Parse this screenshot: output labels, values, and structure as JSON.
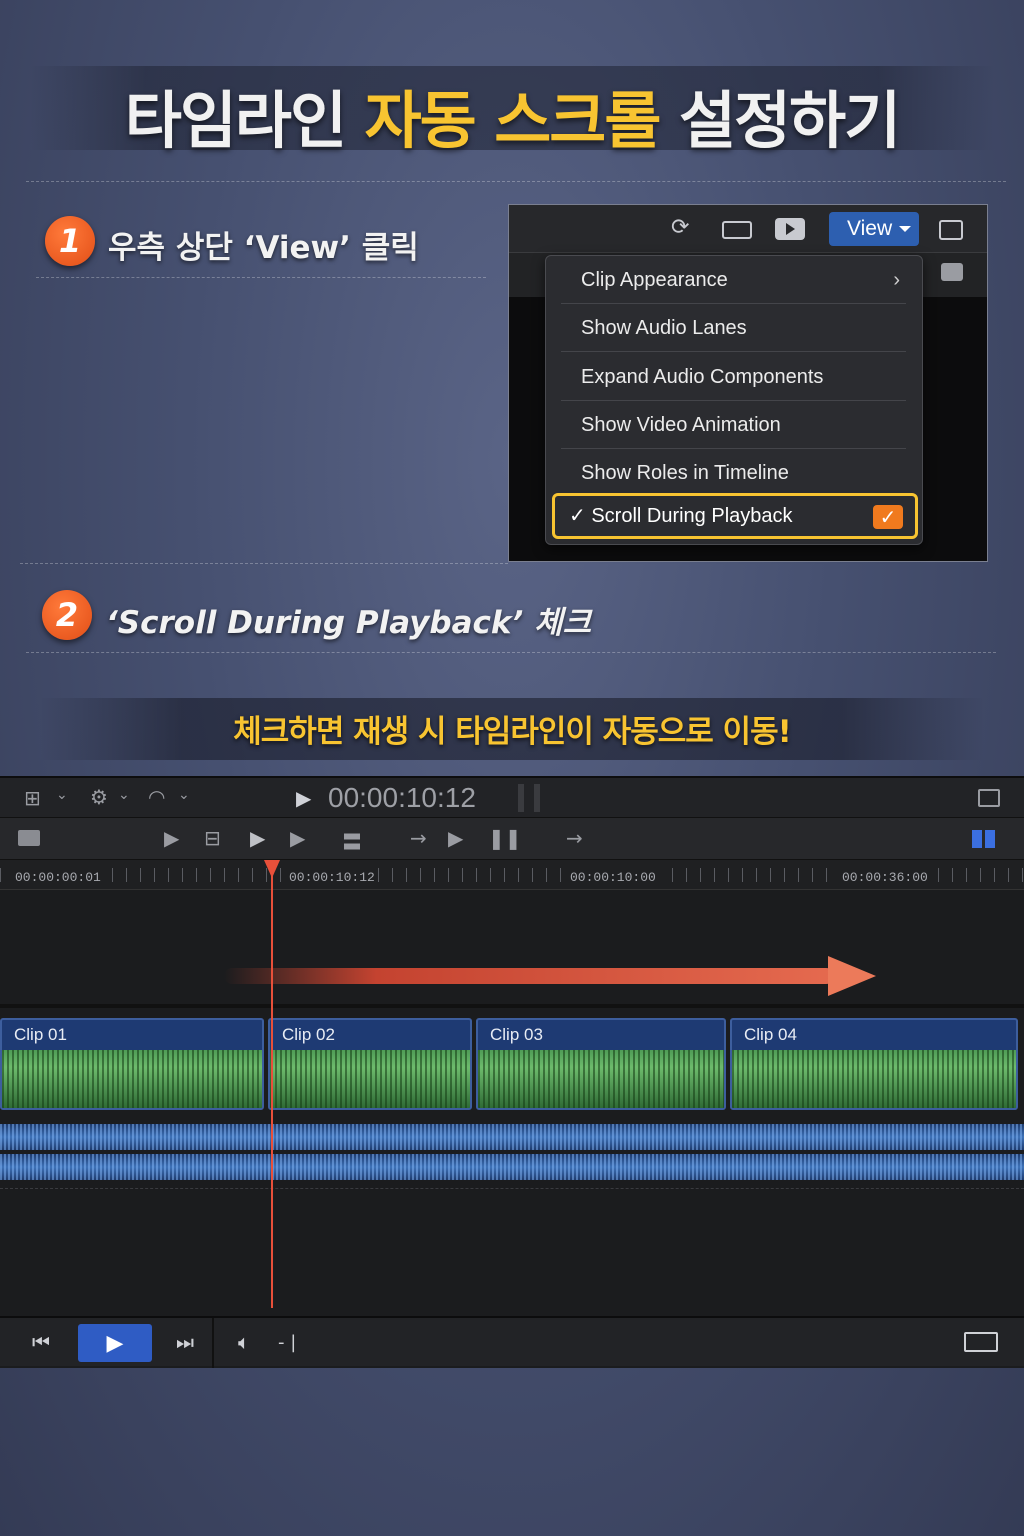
{
  "title": {
    "part1": "타임라인",
    "part2": "자동 스크롤",
    "part3": "설정하기"
  },
  "step1": {
    "number": "1",
    "text": "우측 상단 ‘View’ 클릭"
  },
  "step2": {
    "number": "2",
    "text": "‘Scroll During Playback’ 체크"
  },
  "menu": {
    "view_label": "View",
    "items": [
      {
        "label": "Clip Appearance",
        "submenu": true
      },
      {
        "label": "Show Audio Lanes"
      },
      {
        "label": "Expand Audio Components"
      },
      {
        "label": "Show Video Animation"
      },
      {
        "label": "Show Roles in Timeline"
      }
    ],
    "checked_item": {
      "label": "✓ Scroll During Playback",
      "checked": true
    }
  },
  "caption": "체크하면 재생 시 타임라인이 자동으로 이동!",
  "timeline": {
    "timecode": "00:00:10:12",
    "ruler": [
      "00:00:00:01",
      "00:00:10:12",
      "00:00:10:00",
      "00:00:36:00"
    ],
    "clips": [
      "Clip 01",
      "Clip 02",
      "Clip 03",
      "Clip 04"
    ],
    "volume_text": "- |"
  },
  "colors": {
    "accent_yellow": "#f8c431",
    "badge_orange": "#e24e17",
    "playhead_red": "#e8503a",
    "view_blue": "#2d5fb0"
  }
}
